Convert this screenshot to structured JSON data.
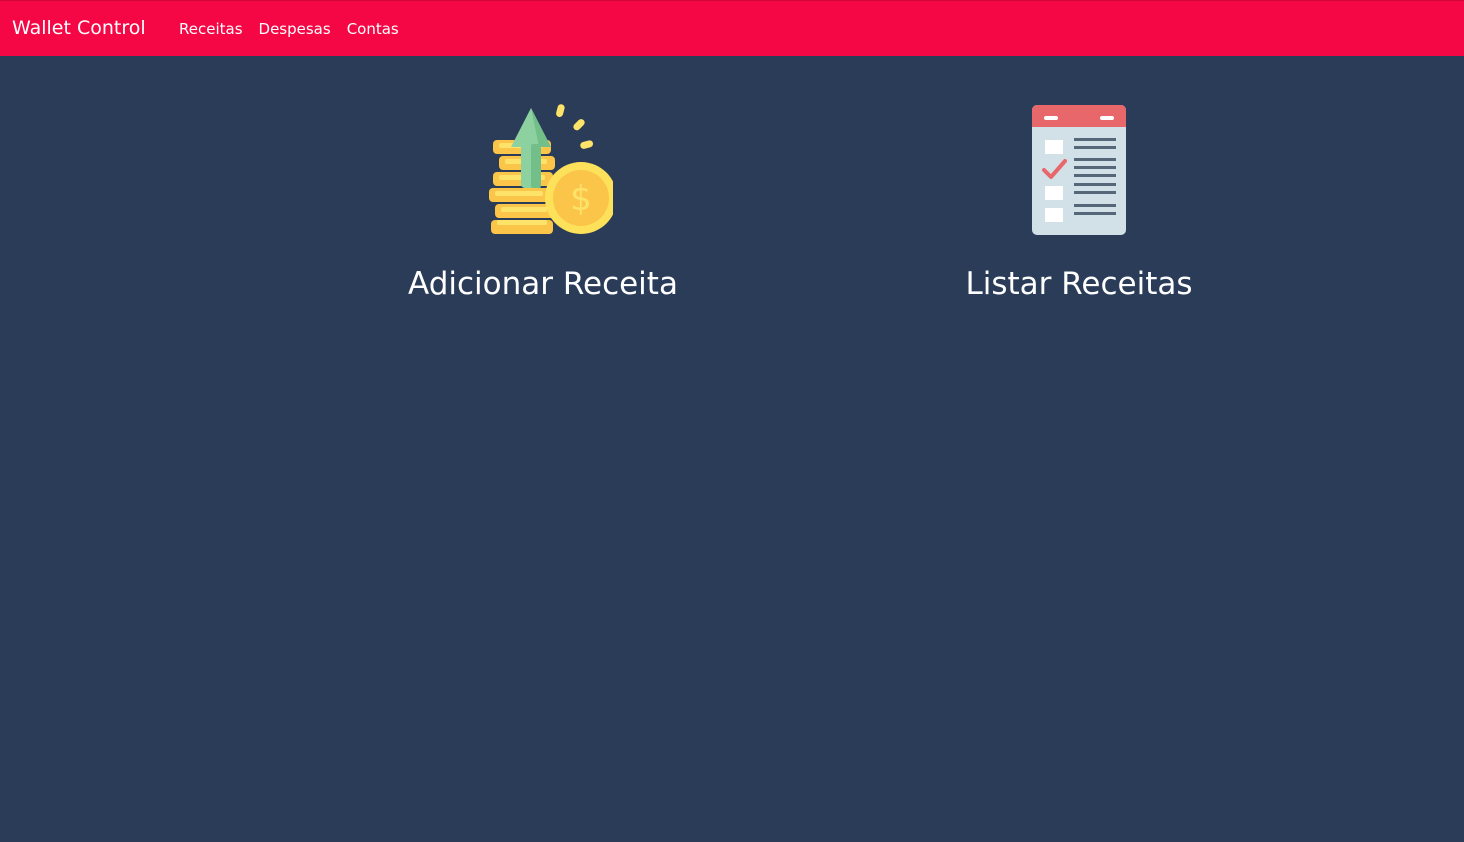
{
  "navbar": {
    "brand": "Wallet Control",
    "links": [
      {
        "label": "Receitas"
      },
      {
        "label": "Despesas"
      },
      {
        "label": "Contas"
      }
    ],
    "background": "#f50745"
  },
  "main": {
    "background": "#2a3c58",
    "cards": [
      {
        "title": "Adicionar Receita",
        "icon": "coins-arrow-up-icon"
      },
      {
        "title": "Listar Receitas",
        "icon": "checklist-icon"
      }
    ]
  }
}
